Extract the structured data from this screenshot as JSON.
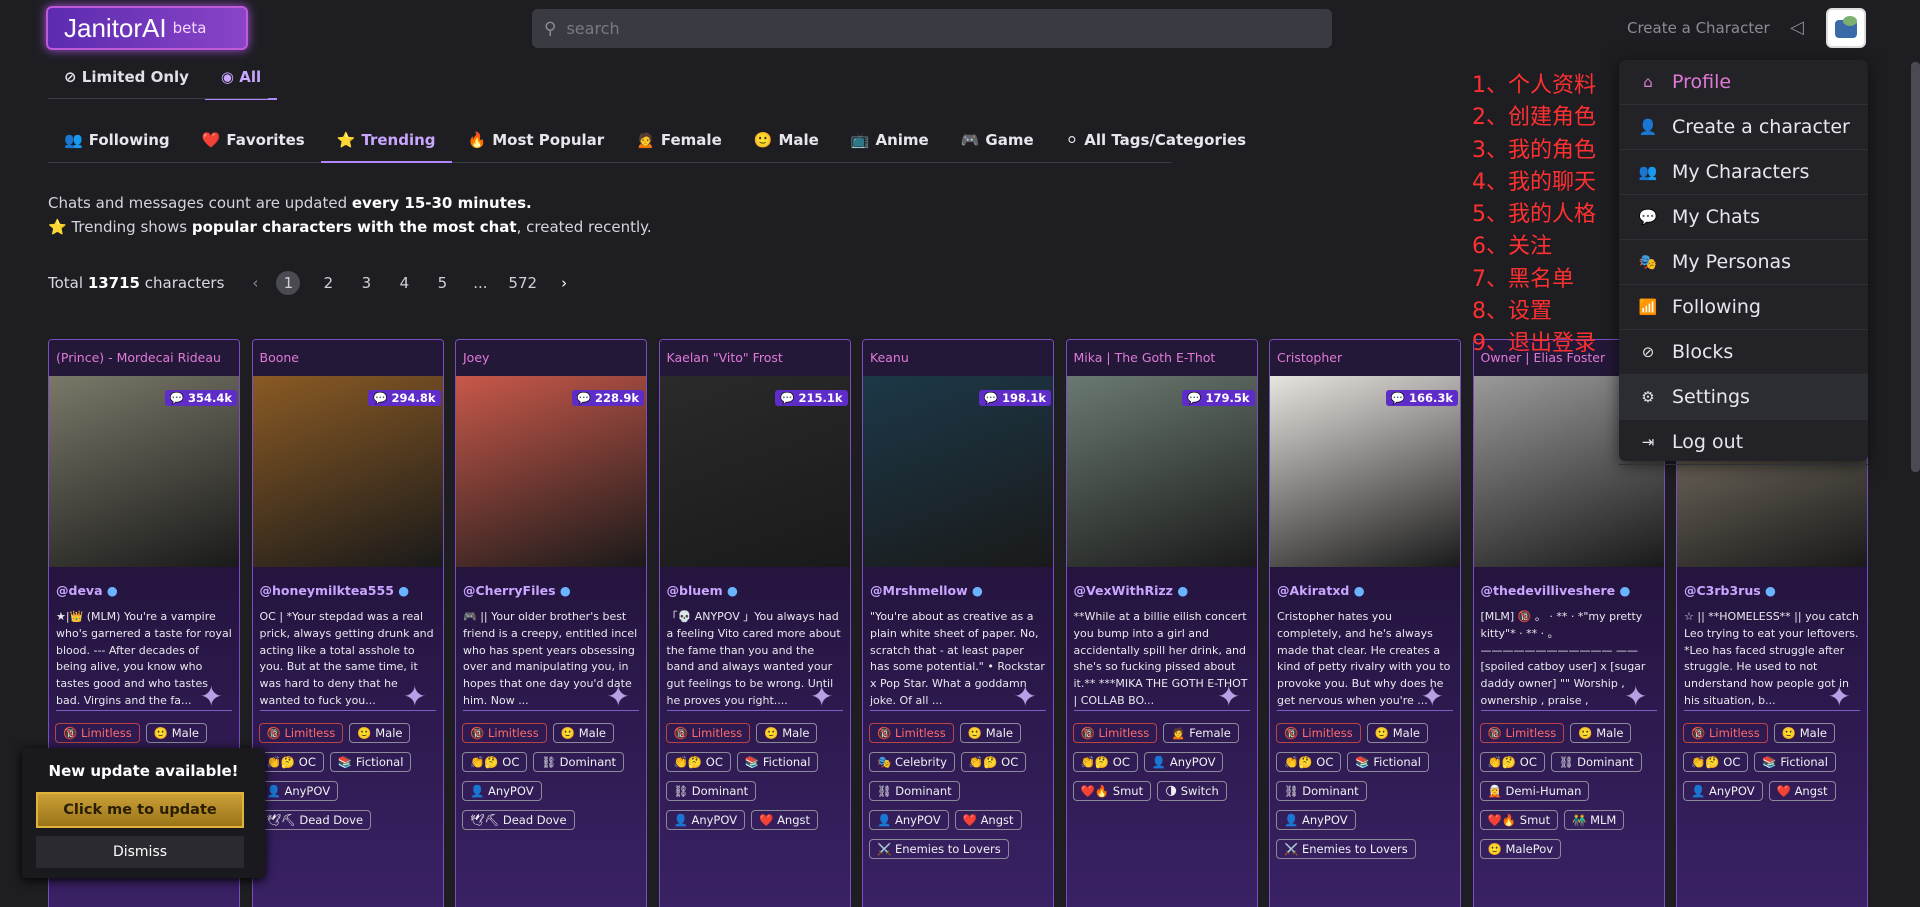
{
  "header": {
    "logo": "JanitorAI",
    "logo_badge": "beta",
    "search_placeholder": "search",
    "create_link": "Create a Character"
  },
  "filters": {
    "limited_only": "Limited Only",
    "all": "All"
  },
  "categories": [
    {
      "icon": "👥",
      "label": "Following"
    },
    {
      "icon": "❤️",
      "label": "Favorites"
    },
    {
      "icon": "⭐",
      "label": "Trending"
    },
    {
      "icon": "🔥",
      "label": "Most Popular"
    },
    {
      "icon": "🙍",
      "label": "Female"
    },
    {
      "icon": "🙂",
      "label": "Male"
    },
    {
      "icon": "📺",
      "label": "Anime"
    },
    {
      "icon": "🎮",
      "label": "Game"
    },
    {
      "icon": "⚪",
      "label": "All Tags/Categories"
    }
  ],
  "info": {
    "line1_pre": "Chats and messages count are updated ",
    "line1_bold": "every 15-30 minutes.",
    "line2_icon": "⭐",
    "line2_pre": " Trending shows ",
    "line2_bold": "popular characters with the most chat",
    "line2_post": ", created recently."
  },
  "pagination": {
    "total_pre": "Total ",
    "total_count": "13715",
    "total_post": " characters",
    "pages": [
      "1",
      "2",
      "3",
      "4",
      "5",
      "...",
      "572"
    ]
  },
  "cards": [
    {
      "title": "(Prince) - Mordecai Rideau",
      "count": "354.4k",
      "creator": "@deva",
      "desc": "★|👑 (MLM) You're a vampire who's garnered a taste for royal blood. --- After decades of being alive, you know who tastes good and who tastes bad. Virgins and the fa...",
      "tags": [
        "🔞 Limitless",
        "🙂 Male"
      ],
      "img": "#7a7868"
    },
    {
      "title": "Boone",
      "count": "294.8k",
      "creator": "@honeymilktea555",
      "desc": "OC | *Your stepdad was a real prick, always getting drunk and acting like a total asshole to you. But at the same time, it was hard to deny that he wanted to fuck you...",
      "tags": [
        "🔞 Limitless",
        "🙂 Male",
        "👏🤔 OC",
        "📚 Fictional",
        "👤 AnyPOV",
        "🕊⛏ Dead Dove"
      ],
      "img": "#8a5a24"
    },
    {
      "title": "Joey",
      "count": "228.9k",
      "creator": "@CherryFiles",
      "desc": "🎮 || Your older brother's best friend is a creepy, entitled incel who has spent years obsessing over and manipulating you, in hopes that one day you'd date him. Now ...",
      "tags": [
        "🔞 Limitless",
        "🙂 Male",
        "👏🤔 OC",
        "⛓ Dominant",
        "👤 AnyPOV",
        "🕊⛏ Dead Dove"
      ],
      "img": "#c8584a"
    },
    {
      "title": "Kaelan \"Vito\" Frost",
      "count": "215.1k",
      "creator": "@bluem",
      "desc": "「💀 ANYPOV 」You always had a feeling Vito cared more about the fame than you and the band and always wanted your gut feelings to be wrong. Until he proves you right....",
      "tags": [
        "🔞 Limitless",
        "🙂 Male",
        "👏🤔 OC",
        "📚 Fictional",
        "⛓ Dominant",
        "👤 AnyPOV",
        "❤️ Angst"
      ],
      "img": "#2a2a2a"
    },
    {
      "title": "Keanu",
      "count": "198.1k",
      "creator": "@Mrshmellow",
      "desc": "\"You're about as creative as a plain white sheet of paper. No, scratch that - at least paper has some potential.\" • Rockstar x Pop Star. What a goddamn joke. Of all ...",
      "tags": [
        "🔞 Limitless",
        "🙂 Male",
        "🎭 Celebrity",
        "👏🤔 OC",
        "⛓ Dominant",
        "👤 AnyPOV",
        "❤️ Angst",
        "⚔️ Enemies to Lovers"
      ],
      "img": "#1c3848"
    },
    {
      "title": "Mika | The Goth E-Thot",
      "count": "179.5k",
      "creator": "@VexWithRizz",
      "desc": "**While at a billie eilish concert you bump into a girl and accidentally spill her drink, and she's so fucking pissed about it.** ***MIKA THE GOTH E-THOT | COLLAB BO...",
      "tags": [
        "🔞 Limitless",
        "🙍 Female",
        "👏🤔 OC",
        "👤 AnyPOV",
        "❤️🔥 Smut",
        "🌗 Switch"
      ],
      "img": "#6a7a70"
    },
    {
      "title": "Cristopher",
      "count": "166.3k",
      "creator": "@Akiratxd",
      "desc": "Cristopher hates you completely, and he's always made that clear. He creates a kind of petty rivalry with you to provoke you. But why does he get nervous when you're ...",
      "tags": [
        "🔞 Limitless",
        "🙂 Male",
        "👏🤔 OC",
        "📚 Fictional",
        "⛓ Dominant",
        "👤 AnyPOV",
        "⚔️ Enemies to Lovers"
      ],
      "img": "#e8e4e0"
    },
    {
      "title": "Owner | Elias Foster",
      "count": "",
      "creator": "@thedevilliveshere",
      "desc": "[MLM] 🔞 。 · ** · *\"my pretty kitty\"* · ** · 。 ———————————— —— [spoiled catboy user] x [sugar daddy owner] \"\" Worship , ownership , praise , materialism , fluff \"\" In th...",
      "tags": [
        "🔞 Limitless",
        "🙂 Male",
        "👏🤔 OC",
        "⛓ Dominant",
        "🧝 Demi-Human",
        "❤️🔥 Smut",
        "👬 MLM",
        "🙂 MalePov"
      ],
      "img": "#9a9a9a"
    },
    {
      "title": "",
      "count": "",
      "creator": "@C3rb3rus",
      "desc": "☆ || **HOMELESS** || you catch Leo trying to eat your leftovers. *Leo has faced struggle after struggle. He used to not understand how people got in his situation, b...",
      "tags": [
        "🔞 Limitless",
        "🙂 Male",
        "👏🤔 OC",
        "📚 Fictional",
        "👤 AnyPOV",
        "❤️ Angst"
      ],
      "img": "#8a8070"
    }
  ],
  "menu": [
    {
      "icon": "⌂",
      "label": "Profile"
    },
    {
      "icon": "👤",
      "label": "Create a character"
    },
    {
      "icon": "👥",
      "label": "My Characters"
    },
    {
      "icon": "💬",
      "label": "My Chats"
    },
    {
      "icon": "🎭",
      "label": "My Personas"
    },
    {
      "icon": "📶",
      "label": "Following"
    },
    {
      "icon": "⊘",
      "label": "Blocks"
    },
    {
      "icon": "⚙",
      "label": "Settings"
    },
    {
      "icon": "⇥",
      "label": "Log out"
    }
  ],
  "annotations": [
    "1、个人资料",
    "2、创建角色",
    "3、我的角色",
    "4、我的聊天",
    "5、我的人格",
    "6、关注",
    "7、黑名单",
    "8、设置",
    "9、退出登录"
  ],
  "toast": {
    "title": "New update available!",
    "update": "Click me to update",
    "dismiss": "Dismiss"
  },
  "colors": {
    "accent": "#b086ff",
    "pink": "#e07ad8",
    "annotation": "#ff3030"
  }
}
